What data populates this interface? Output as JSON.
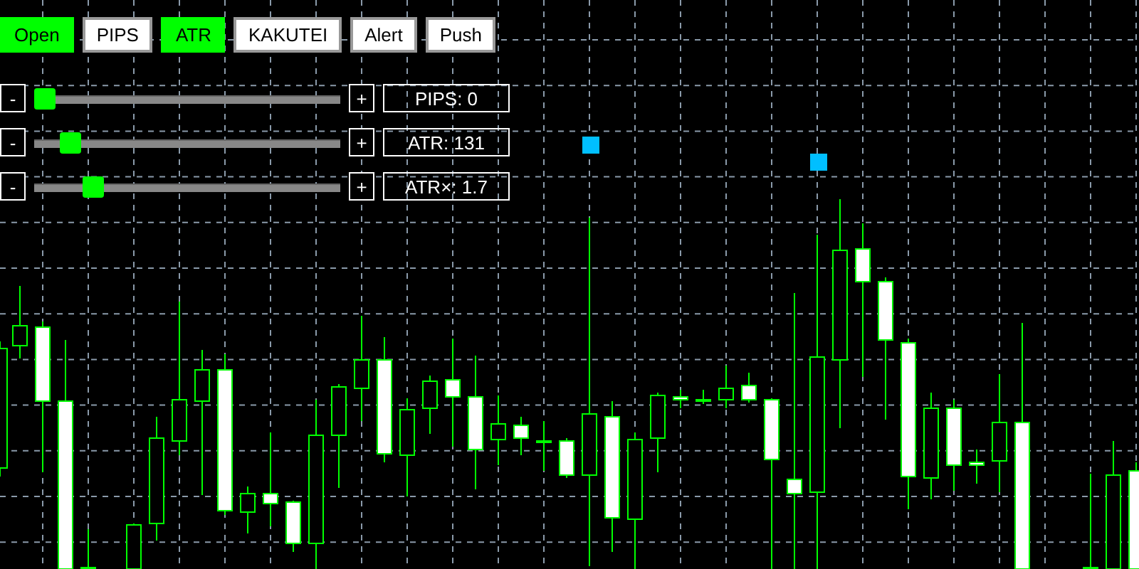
{
  "buttons": [
    {
      "label": "Open",
      "on": true
    },
    {
      "label": "PIPS",
      "on": false
    },
    {
      "label": "ATR",
      "on": true
    },
    {
      "label": "KAKUTEI",
      "on": false
    },
    {
      "label": "Alert",
      "on": false
    },
    {
      "label": "Push",
      "on": false
    }
  ],
  "sliders": [
    {
      "minus": "-",
      "plus": "+",
      "level": 0,
      "reading": "PIPS: 0"
    },
    {
      "minus": "-",
      "plus": "+",
      "level": 0.09,
      "reading": "ATR: 131"
    },
    {
      "minus": "-",
      "plus": "+",
      "level": 0.17,
      "reading": "ATR×: 1.7"
    }
  ]
}
